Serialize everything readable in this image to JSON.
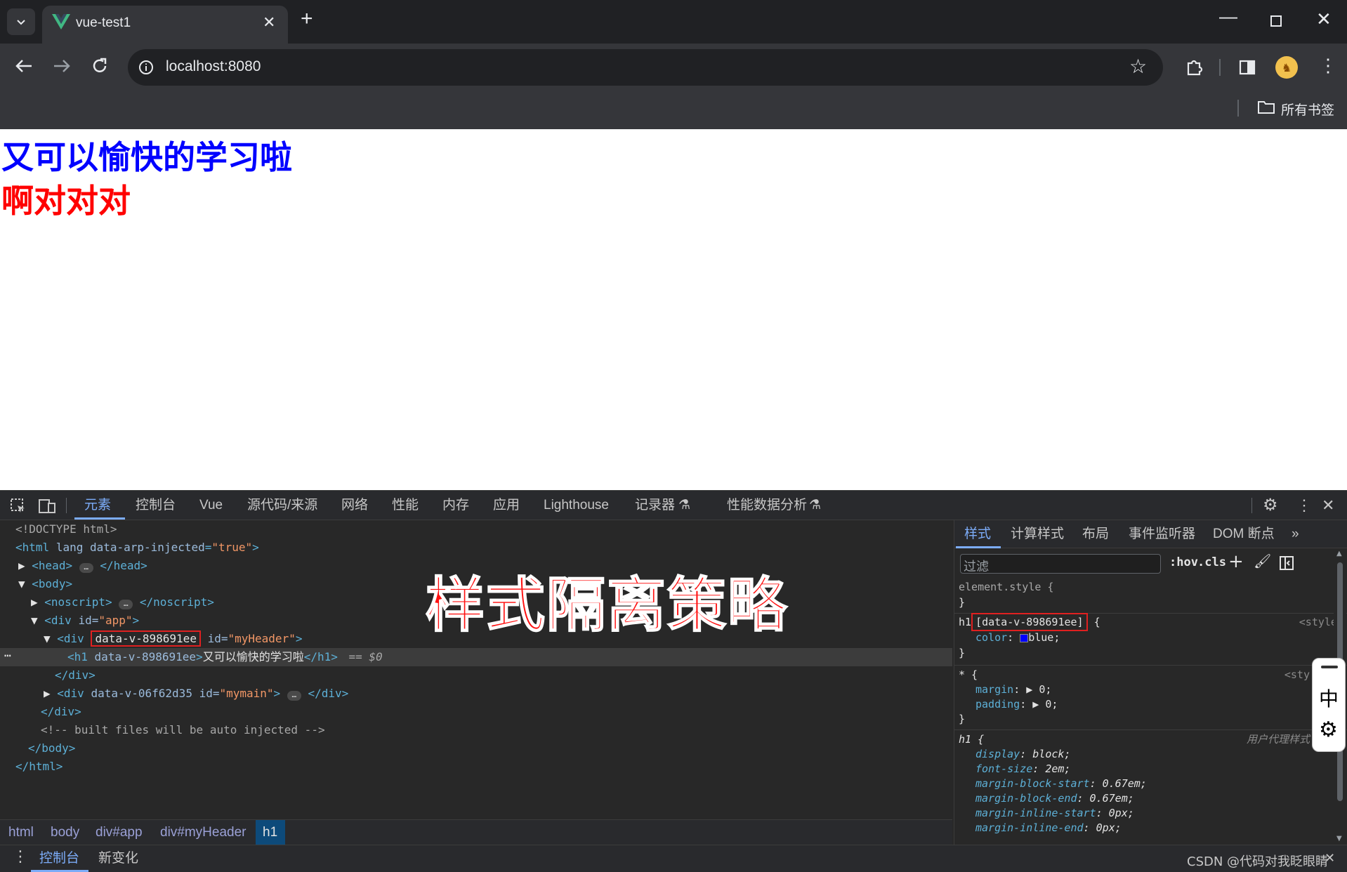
{
  "browser": {
    "tab_title": "vue-test1",
    "url": "localhost:8080",
    "bookmarks_label": "所有书签"
  },
  "page": {
    "heading1": "又可以愉快的学习啦",
    "heading2": "啊对对对",
    "heading1_color": "#0000ff",
    "heading2_color": "#ff0000"
  },
  "overlay": {
    "title": "样式隔离策略",
    "color": "#ff1010"
  },
  "devtools": {
    "tabs": [
      "元素",
      "控制台",
      "Vue",
      "源代码/来源",
      "网络",
      "性能",
      "内存",
      "应用",
      "Lighthouse",
      "记录器",
      "性能数据分析"
    ],
    "active_tab": "元素",
    "dom": {
      "doctype": "<!DOCTYPE html>",
      "html_open": "<html",
      "html_attr": "lang data-arp-injected",
      "html_attr_val": "\"true\"",
      "head": "<head>",
      "head_close": "</head>",
      "body_open": "<body>",
      "noscript": "<noscript>",
      "noscript_close": "</noscript>",
      "div_app": "<div",
      "div_app_attr": "id=",
      "div_app_val": "\"app\"",
      "div_header_tag": "<div",
      "div_header_scoped": "data-v-898691ee",
      "div_header_attr": "id=",
      "div_header_val": "\"myHeader\"",
      "h1_tag": "<h1",
      "h1_attr": "data-v-898691ee",
      "h1_text": "又可以愉快的学习啦",
      "h1_close": "</h1>",
      "h1_marker": "== $0",
      "div_close": "</div>",
      "div_main_tag": "<div",
      "div_main_attr": "data-v-06f62d35 id=",
      "div_main_val": "\"mymain\"",
      "div_main_close": "</div>",
      "app_close": "</div>",
      "comment": "<!-- built files will be auto injected -->",
      "body_close": "</body>",
      "html_close": "</html>"
    },
    "styles_tabs": [
      "样式",
      "计算样式",
      "布局",
      "事件监听器",
      "DOM 断点"
    ],
    "filter_placeholder": "过滤",
    "hov": ":hov",
    "cls": ".cls",
    "rules": {
      "element_style": "element.style {",
      "close": "}",
      "scoped_selector_prefix": "h1",
      "scoped_selector": "[data-v-898691ee]",
      "open_brace": " {",
      "scoped_source": "<style>",
      "color_prop": "color",
      "color_val": "blue;",
      "universal_selector": "* {",
      "universal_source": "<sty",
      "margin_prop": "margin",
      "margin_val": "0;",
      "padding_prop": "padding",
      "padding_val": "0;",
      "ua_selector": "h1 {",
      "ua_source": "用户代理样式",
      "ua_props": [
        {
          "p": "display",
          "v": "block;"
        },
        {
          "p": "font-size",
          "v": "2em;"
        },
        {
          "p": "margin-block-start",
          "v": "0.67em;"
        },
        {
          "p": "margin-block-end",
          "v": "0.67em;"
        },
        {
          "p": "margin-inline-start",
          "v": "0px;"
        },
        {
          "p": "margin-inline-end",
          "v": "0px;"
        }
      ]
    },
    "breadcrumbs": [
      "html",
      "body",
      "div#app",
      "div#myHeader",
      "h1"
    ],
    "drawer_tabs": [
      "控制台",
      "新变化"
    ],
    "ime_label": "中",
    "watermark": "CSDN @代码对我眨眼睛"
  }
}
